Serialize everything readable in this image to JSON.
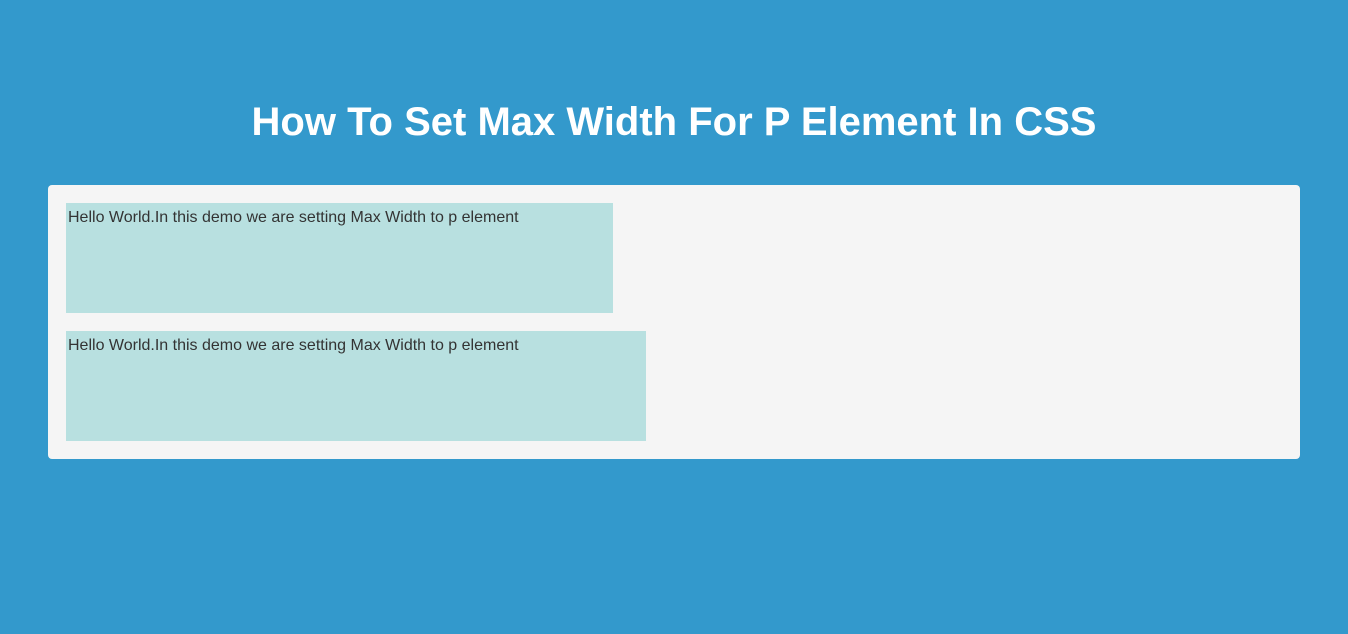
{
  "page": {
    "title": "How To Set Max Width For P Element In CSS"
  },
  "paragraphs": [
    {
      "text": "Hello World.In this demo we are setting Max Width to p element"
    },
    {
      "text": "Hello World.In this demo we are setting Max Width to p element"
    }
  ],
  "colors": {
    "background": "#3399cc",
    "panel": "#f5f5f5",
    "paragraphBg": "#b8e0e0",
    "titleText": "#ffffff",
    "bodyText": "#333333"
  }
}
